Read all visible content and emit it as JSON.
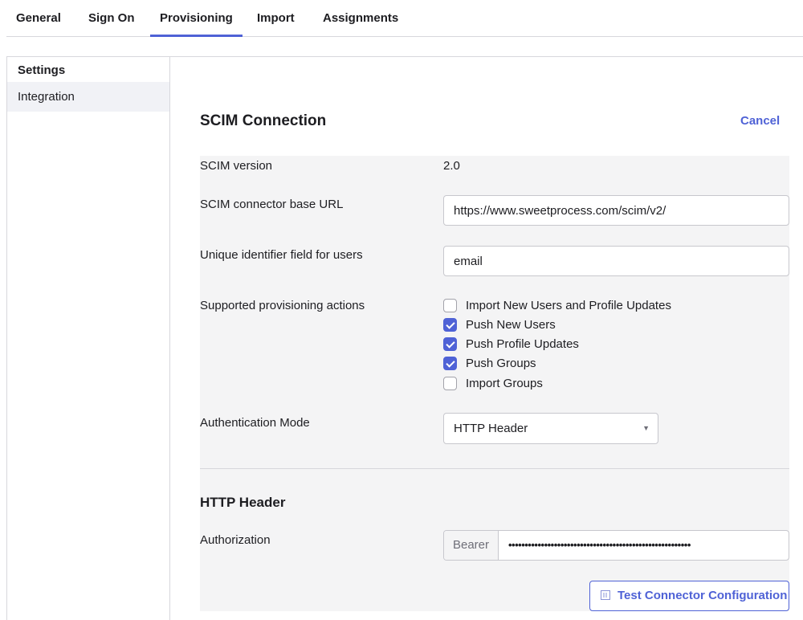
{
  "tabs": [
    {
      "label": "General"
    },
    {
      "label": "Sign On"
    },
    {
      "label": "Provisioning",
      "active": true
    },
    {
      "label": "Import"
    },
    {
      "label": "Assignments"
    }
  ],
  "sidebar": {
    "title": "Settings",
    "items": [
      {
        "label": "Integration",
        "active": true
      }
    ]
  },
  "main": {
    "title": "SCIM Connection",
    "cancel_label": "Cancel",
    "scim_version_label": "SCIM version",
    "scim_version_value": "2.0",
    "base_url_label": "SCIM connector base URL",
    "base_url_value": "https://www.sweetprocess.com/scim/v2/",
    "unique_id_label": "Unique identifier field for users",
    "unique_id_value": "email",
    "actions_label": "Supported provisioning actions",
    "actions": [
      {
        "label": "Import New Users and Profile Updates",
        "checked": false
      },
      {
        "label": "Push New Users",
        "checked": true
      },
      {
        "label": "Push Profile Updates",
        "checked": true
      },
      {
        "label": "Push Groups",
        "checked": true
      },
      {
        "label": "Import Groups",
        "checked": false
      }
    ],
    "auth_mode_label": "Authentication Mode",
    "auth_mode_value": "HTTP Header",
    "http_header_title": "HTTP Header",
    "authorization_label": "Authorization",
    "authorization_prefix": "Bearer",
    "authorization_masked": "••••••••••••••••••••••••••••••••••••••••••••••••••••••••",
    "test_button_label": "Test Connector Configuration"
  },
  "colors": {
    "accent": "#4f62d6",
    "form_background": "#f4f4f5",
    "sidebar_active": "#f1f2f6"
  },
  "icons": {
    "select_arrow": "chevron-down-icon",
    "test_button": "connector-test-icon"
  }
}
